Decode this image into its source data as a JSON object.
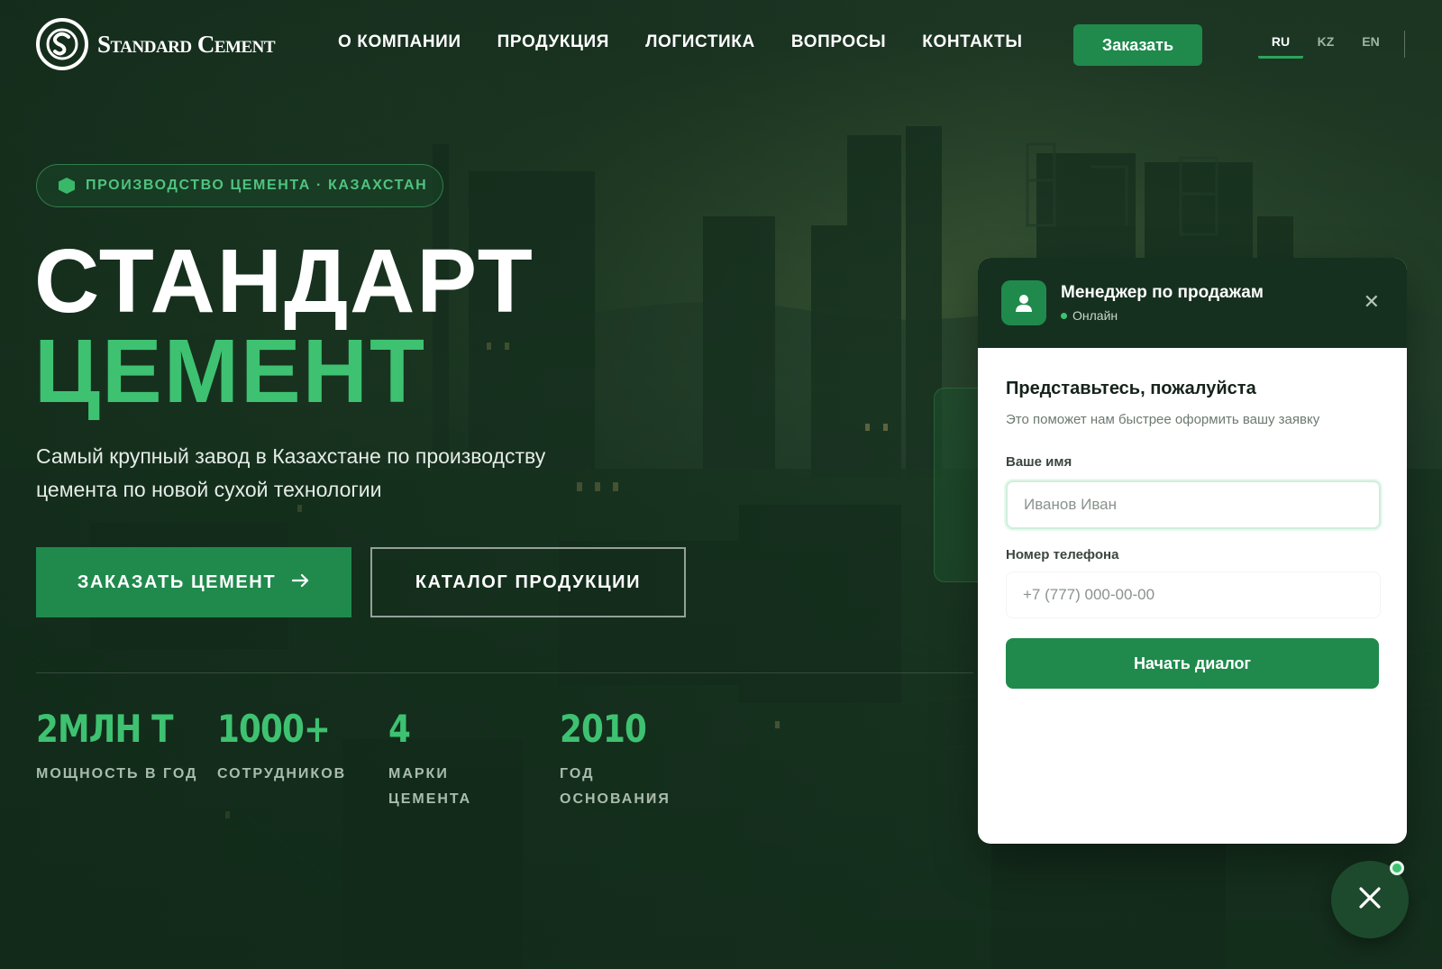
{
  "brand": {
    "name": "Standard Cement",
    "logo_icon": "sc-monogram-icon"
  },
  "nav": {
    "items": [
      "О КОМПАНИИ",
      "ПРОДУКЦИЯ",
      "ЛОГИСТИКА",
      "ВОПРОСЫ",
      "КОНТАКТЫ"
    ],
    "order_label": "Заказать"
  },
  "languages": {
    "items": [
      "RU",
      "KZ",
      "EN"
    ],
    "active": "RU"
  },
  "hero": {
    "badge": "ПРОИЗВОДСТВО ЦЕМЕНТА · КАЗАХСТАН",
    "title_line1": "СТАНДАРТ",
    "title_line2": "ЦЕМЕНТ",
    "subtitle": "Самый крупный завод в Казахстане по производству цемента по новой сухой технологии",
    "primary_button": "ЗАКАЗАТЬ ЦЕМЕНТ",
    "secondary_button": "КАТАЛОГ ПРОДУКЦИИ",
    "stats": [
      {
        "value": "2МЛН Т",
        "label": "МОЩНОСТЬ В ГОД"
      },
      {
        "value": "1000+",
        "label": "СОТРУДНИКОВ"
      },
      {
        "value": "4",
        "label": "МАРКИ ЦЕМЕНТА"
      },
      {
        "value": "2010",
        "label": "ГОД ОСНОВАНИЯ"
      }
    ]
  },
  "chat": {
    "header_title": "Менеджер по продажам",
    "status": "Онлайн",
    "title": "Представьтесь, пожалуйста",
    "description": "Это поможет нам быстрее оформить вашу заявку",
    "name_label": "Ваше имя",
    "name_placeholder": "Иванов Иван",
    "phone_label": "Номер телефона",
    "phone_placeholder": "+7 (777) 000-00-00",
    "submit_label": "Начать диалог"
  },
  "colors": {
    "accent": "#1f8a4c",
    "accent_light": "#3ec271",
    "header_dark": "#16301f"
  }
}
